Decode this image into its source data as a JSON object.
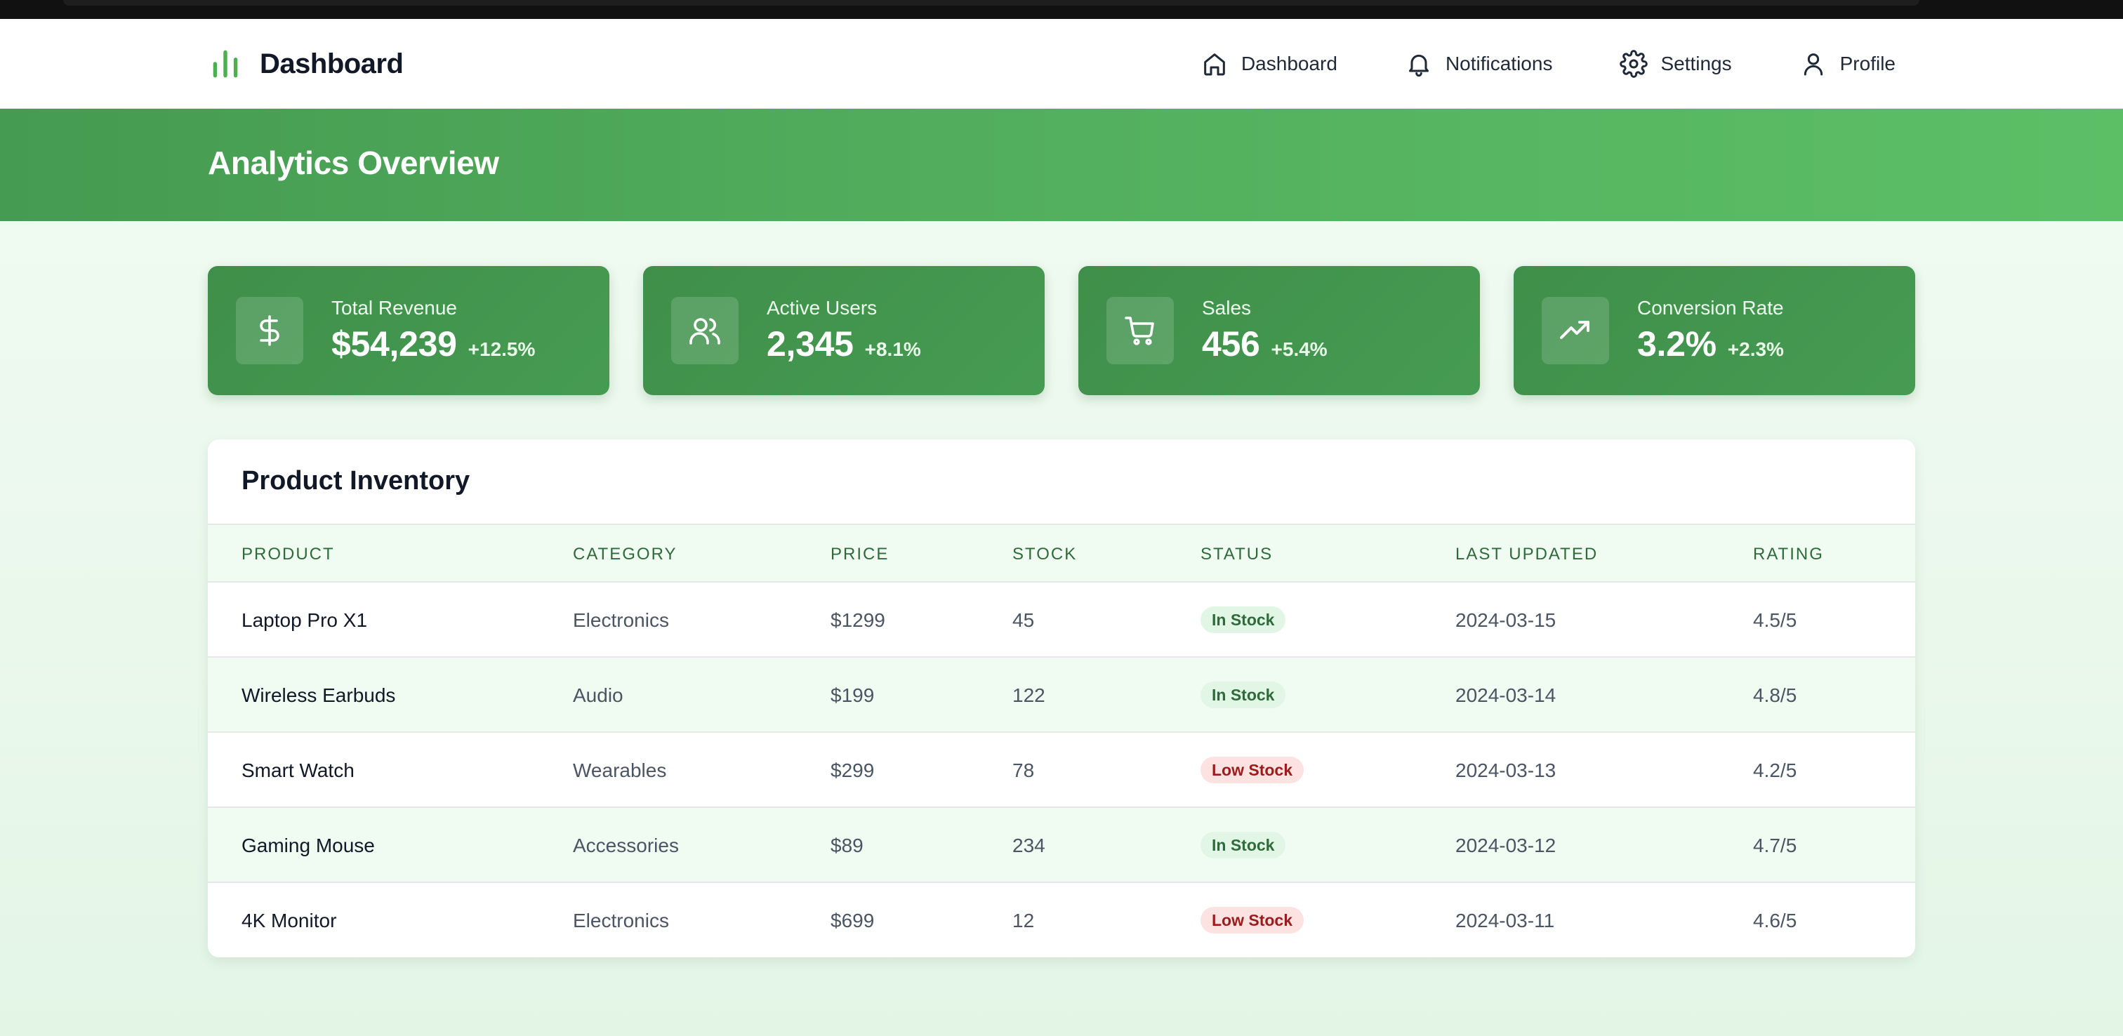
{
  "header": {
    "title": "Dashboard",
    "nav": [
      {
        "label": "Dashboard",
        "icon": "home-icon"
      },
      {
        "label": "Notifications",
        "icon": "bell-icon"
      },
      {
        "label": "Settings",
        "icon": "gear-icon"
      },
      {
        "label": "Profile",
        "icon": "user-icon"
      }
    ]
  },
  "hero": {
    "title": "Analytics Overview"
  },
  "stats": [
    {
      "label": "Total Revenue",
      "value": "$54,239",
      "change": "+12.5%",
      "icon": "dollar-icon"
    },
    {
      "label": "Active Users",
      "value": "2,345",
      "change": "+8.1%",
      "icon": "users-icon"
    },
    {
      "label": "Sales",
      "value": "456",
      "change": "+5.4%",
      "icon": "cart-icon"
    },
    {
      "label": "Conversion Rate",
      "value": "3.2%",
      "change": "+2.3%",
      "icon": "trending-up-icon"
    }
  ],
  "inventory": {
    "title": "Product Inventory",
    "columns": [
      "PRODUCT",
      "CATEGORY",
      "PRICE",
      "STOCK",
      "STATUS",
      "LAST UPDATED",
      "RATING"
    ],
    "rows": [
      {
        "product": "Laptop Pro X1",
        "category": "Electronics",
        "price": "$1299",
        "stock": "45",
        "status": "In Stock",
        "updated": "2024-03-15",
        "rating": "4.5/5"
      },
      {
        "product": "Wireless Earbuds",
        "category": "Audio",
        "price": "$199",
        "stock": "122",
        "status": "In Stock",
        "updated": "2024-03-14",
        "rating": "4.8/5"
      },
      {
        "product": "Smart Watch",
        "category": "Wearables",
        "price": "$299",
        "stock": "78",
        "status": "Low Stock",
        "updated": "2024-03-13",
        "rating": "4.2/5"
      },
      {
        "product": "Gaming Mouse",
        "category": "Accessories",
        "price": "$89",
        "stock": "234",
        "status": "In Stock",
        "updated": "2024-03-12",
        "rating": "4.7/5"
      },
      {
        "product": "4K Monitor",
        "category": "Electronics",
        "price": "$699",
        "stock": "12",
        "status": "Low Stock",
        "updated": "2024-03-11",
        "rating": "4.6/5"
      }
    ]
  },
  "colors": {
    "brand_green": "#4caf50",
    "header_gradient_start": "#459b51",
    "header_gradient_end": "#5cbf66",
    "card_green": "#439650",
    "in_stock_bg": "#e2f6e6",
    "low_stock_bg": "#fde2e2"
  }
}
